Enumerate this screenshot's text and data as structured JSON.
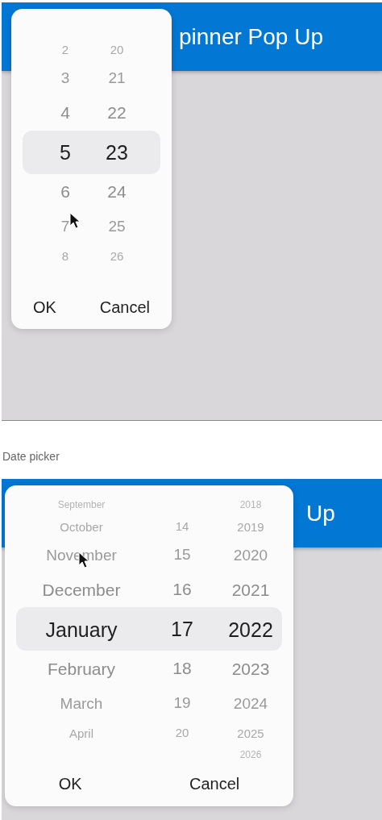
{
  "spinner_screen": {
    "title": "pinner Pop Up",
    "columns": [
      {
        "items": [
          {
            "text": "2",
            "selected": false
          },
          {
            "text": "3",
            "selected": false
          },
          {
            "text": "4",
            "selected": false
          },
          {
            "text": "5",
            "selected": true
          },
          {
            "text": "6",
            "selected": false
          },
          {
            "text": "7",
            "selected": false
          },
          {
            "text": "8",
            "selected": false
          }
        ]
      },
      {
        "items": [
          {
            "text": "20",
            "selected": false
          },
          {
            "text": "21",
            "selected": false
          },
          {
            "text": "22",
            "selected": false
          },
          {
            "text": "23",
            "selected": true
          },
          {
            "text": "24",
            "selected": false
          },
          {
            "text": "25",
            "selected": false
          },
          {
            "text": "26",
            "selected": false
          }
        ]
      }
    ],
    "buttons": [
      "OK",
      "Cancel"
    ]
  },
  "caption": "Date picker",
  "date_screen": {
    "title": "Up",
    "columns": [
      {
        "items": [
          {
            "text": "September",
            "selected": false
          },
          {
            "text": "October",
            "selected": false
          },
          {
            "text": "November",
            "selected": false
          },
          {
            "text": "December",
            "selected": false
          },
          {
            "text": "January",
            "selected": true
          },
          {
            "text": "February",
            "selected": false
          },
          {
            "text": "March",
            "selected": false
          },
          {
            "text": "April",
            "selected": false
          }
        ]
      },
      {
        "items": [
          {
            "text": "14",
            "selected": false
          },
          {
            "text": "15",
            "selected": false
          },
          {
            "text": "16",
            "selected": false
          },
          {
            "text": "17",
            "selected": true
          },
          {
            "text": "18",
            "selected": false
          },
          {
            "text": "19",
            "selected": false
          },
          {
            "text": "20",
            "selected": false
          }
        ]
      },
      {
        "items": [
          {
            "text": "2018",
            "selected": false
          },
          {
            "text": "2019",
            "selected": false
          },
          {
            "text": "2020",
            "selected": false
          },
          {
            "text": "2021",
            "selected": false
          },
          {
            "text": "2022",
            "selected": true
          },
          {
            "text": "2023",
            "selected": false
          },
          {
            "text": "2024",
            "selected": false
          },
          {
            "text": "2025",
            "selected": false
          },
          {
            "text": "2026",
            "selected": false
          }
        ]
      }
    ],
    "buttons": [
      "OK",
      "Cancel"
    ]
  }
}
